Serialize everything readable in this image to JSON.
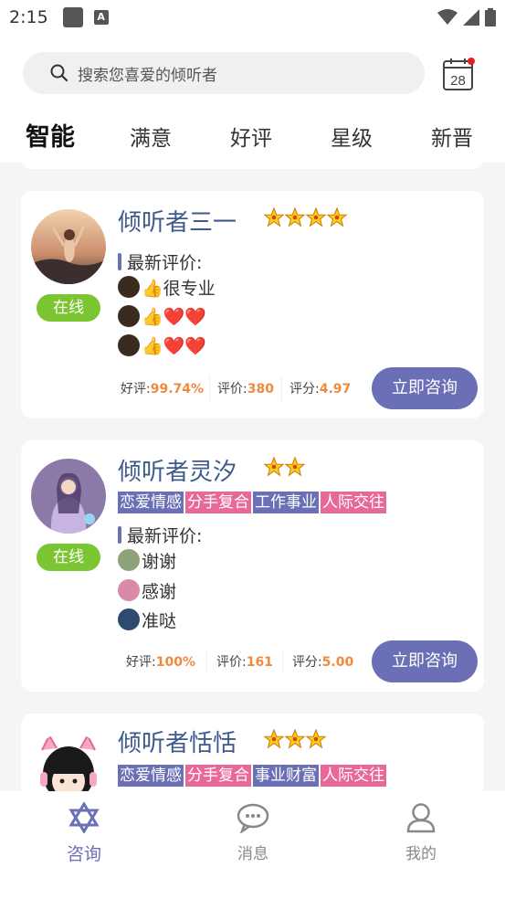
{
  "status_bar": {
    "time": "2:15",
    "a_icon": "A"
  },
  "search": {
    "placeholder": "搜索您喜爱的倾听者"
  },
  "calendar": {
    "day": "28"
  },
  "tabs": [
    "智能",
    "满意",
    "好评",
    "星级",
    "新晋"
  ],
  "listeners": [
    {
      "name": "倾听者三一",
      "stars": 4,
      "status": "在线",
      "review_title": "最新评价:",
      "reviews": [
        "👍很专业",
        "👍❤️❤️",
        "👍❤️❤️"
      ],
      "stats": {
        "good_label": "好评:",
        "good_value": "99.74%",
        "count_label": "评价:",
        "count_value": "380",
        "score_label": "评分:",
        "score_value": "4.97"
      },
      "button": "立即咨询"
    },
    {
      "name": "倾听者灵汐",
      "stars": 2,
      "status": "在线",
      "tags": [
        "恋爱情感",
        "分手复合",
        "工作事业",
        "人际交往"
      ],
      "review_title": "最新评价:",
      "reviews": [
        "谢谢",
        "感谢",
        "准哒"
      ],
      "stats": {
        "good_label": "好评:",
        "good_value": "100%",
        "count_label": "评价:",
        "count_value": "161",
        "score_label": "评分:",
        "score_value": "5.00"
      },
      "button": "立即咨询"
    },
    {
      "name": "倾听者恬恬",
      "stars": 3,
      "tags": [
        "恋爱情感",
        "分手复合",
        "事业财富",
        "人际交往"
      ]
    }
  ],
  "tabbar": [
    {
      "label": "咨询",
      "icon": "star-of-david-icon"
    },
    {
      "label": "消息",
      "icon": "chat-bubble-icon"
    },
    {
      "label": "我的",
      "icon": "user-icon"
    }
  ],
  "colors": {
    "accent": "#6b6fb5",
    "pink": "#e9689a",
    "green": "#7cc532",
    "orange": "#f08a3c",
    "name": "#3d5a8c"
  }
}
